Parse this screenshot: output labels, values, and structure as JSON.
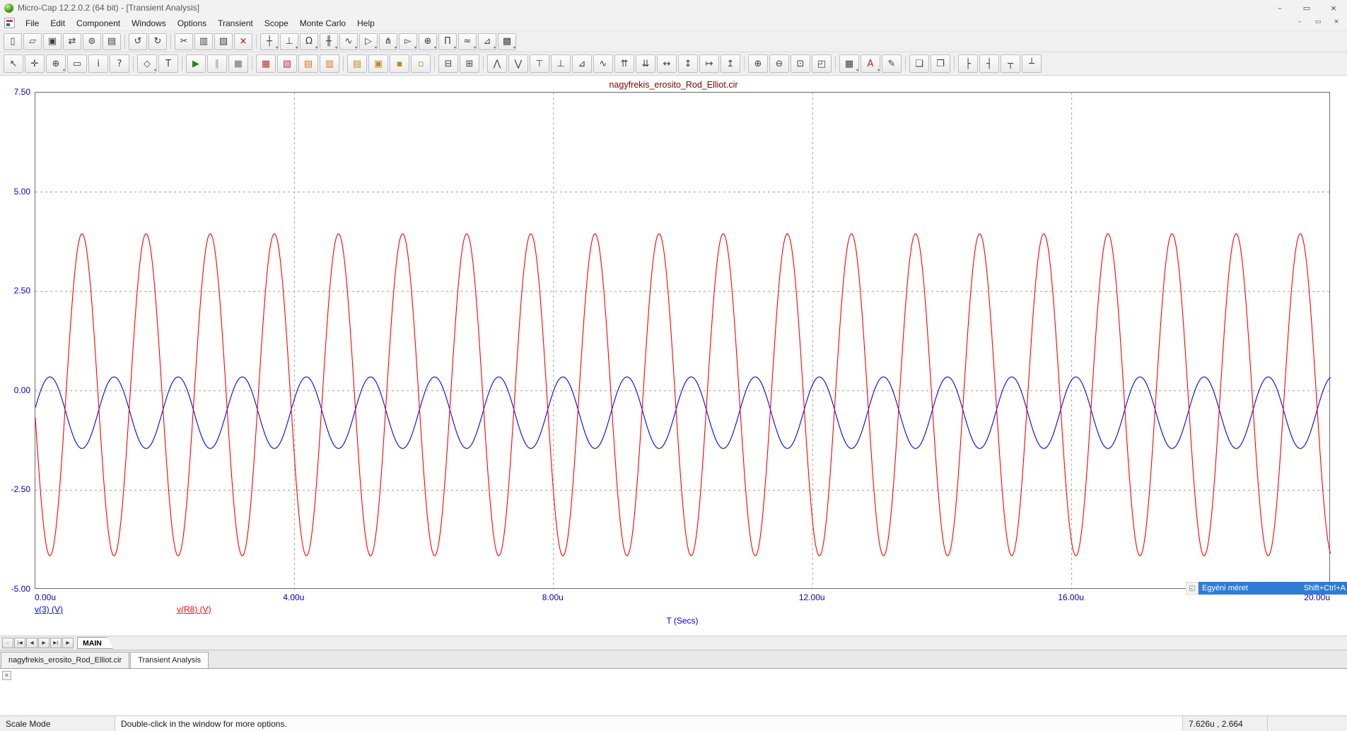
{
  "window": {
    "title": "Micro-Cap 12.2.0.2 (64 bit) - [Transient Analysis]",
    "controls": [
      {
        "name": "minimize",
        "glyph": "–"
      },
      {
        "name": "restore",
        "glyph": "▭"
      },
      {
        "name": "close",
        "glyph": "×"
      }
    ],
    "child_controls": [
      {
        "name": "child-minimize",
        "glyph": "–"
      },
      {
        "name": "child-restore",
        "glyph": "▭"
      },
      {
        "name": "child-close",
        "glyph": "×"
      }
    ]
  },
  "menu": {
    "items": [
      "File",
      "Edit",
      "Component",
      "Windows",
      "Options",
      "Transient",
      "Scope",
      "Monte Carlo",
      "Help"
    ]
  },
  "toolbar_file": {
    "items": [
      {
        "name": "new-file",
        "glyph": "▯"
      },
      {
        "name": "open-file",
        "glyph": "▱"
      },
      {
        "name": "save-file",
        "glyph": "▣"
      },
      {
        "name": "translate",
        "glyph": "⇄"
      },
      {
        "name": "session",
        "glyph": "⊚"
      },
      {
        "name": "print",
        "glyph": "▤"
      },
      {
        "type": "sep"
      },
      {
        "name": "undo",
        "glyph": "↺"
      },
      {
        "name": "redo",
        "glyph": "↻"
      },
      {
        "type": "sep"
      },
      {
        "name": "cut",
        "glyph": "✂"
      },
      {
        "name": "copy",
        "glyph": "▥"
      },
      {
        "name": "paste",
        "glyph": "▧"
      },
      {
        "name": "delete",
        "glyph": "×",
        "color": "#b00000"
      },
      {
        "type": "sep"
      },
      {
        "name": "wire-mode",
        "glyph": "┼",
        "dropdown": true
      },
      {
        "name": "ground-component",
        "glyph": "⊥",
        "dropdown": true
      },
      {
        "name": "resistor-component",
        "glyph": "Ω",
        "dropdown": true
      },
      {
        "name": "capacitor-component",
        "glyph": "╫",
        "dropdown": true
      },
      {
        "name": "inductor-component",
        "glyph": "∿",
        "dropdown": true
      },
      {
        "name": "diode-component",
        "glyph": "▷",
        "dropdown": true
      },
      {
        "name": "bjt-component",
        "glyph": "⋔",
        "dropdown": true
      },
      {
        "name": "opamp-component",
        "glyph": "▻",
        "dropdown": true
      },
      {
        "name": "source-component",
        "glyph": "⊕",
        "dropdown": true
      },
      {
        "name": "pulse-source-component",
        "glyph": "Π",
        "dropdown": true
      },
      {
        "name": "sine-source-component",
        "glyph": "≈",
        "dropdown": true
      },
      {
        "name": "switch-component",
        "glyph": "⊿",
        "dropdown": true
      },
      {
        "name": "macro-component",
        "glyph": "▩",
        "dropdown": true
      }
    ]
  },
  "toolbar_analysis": {
    "items": [
      {
        "name": "select-mode",
        "glyph": "↖"
      },
      {
        "name": "pan-mode",
        "glyph": "✛"
      },
      {
        "name": "zoom-mode",
        "glyph": "⊕",
        "dropdown": true
      },
      {
        "name": "select-region-mode",
        "glyph": "▭"
      },
      {
        "name": "info-mode",
        "glyph": "i"
      },
      {
        "name": "help-mode",
        "glyph": "?"
      },
      {
        "type": "sep"
      },
      {
        "name": "graphics-mode",
        "glyph": "◇",
        "dropdown": true
      },
      {
        "name": "text-mode",
        "glyph": "T"
      },
      {
        "type": "sep"
      },
      {
        "name": "run-analysis",
        "glyph": "▶",
        "color": "#1d8a1d"
      },
      {
        "name": "pause-analysis",
        "glyph": "∥",
        "color": "#9a9a9a"
      },
      {
        "name": "stop-analysis",
        "glyph": "■",
        "color": "#9a9a9a"
      },
      {
        "type": "sep"
      },
      {
        "name": "analysis-limits",
        "glyph": "▦",
        "color": "#c03030"
      },
      {
        "name": "stepping",
        "glyph": "▧",
        "color": "#c03030"
      },
      {
        "name": "optimize",
        "glyph": "▤",
        "color": "#d07a20"
      },
      {
        "name": "state-variables",
        "glyph": "▥",
        "color": "#d07a20"
      },
      {
        "type": "sep"
      },
      {
        "name": "numeric-output",
        "glyph": "▤",
        "color": "#c08820"
      },
      {
        "name": "watch",
        "glyph": "▣",
        "color": "#c08820"
      },
      {
        "name": "breakpoints",
        "glyph": "▪",
        "color": "#c08820"
      },
      {
        "name": "animate",
        "glyph": "▫",
        "color": "#c08820"
      },
      {
        "type": "sep"
      },
      {
        "name": "split-horizontal",
        "glyph": "⊟"
      },
      {
        "name": "split-vertical",
        "glyph": "⊞"
      },
      {
        "type": "sep"
      },
      {
        "name": "peak-tag",
        "glyph": "⋀"
      },
      {
        "name": "valley-tag",
        "glyph": "⋁"
      },
      {
        "name": "high-tag",
        "glyph": "⊤"
      },
      {
        "name": "low-tag",
        "glyph": "⊥"
      },
      {
        "name": "slope-tag",
        "glyph": "⊿"
      },
      {
        "name": "inflection-tag",
        "glyph": "∿"
      },
      {
        "name": "global-high",
        "glyph": "⇈"
      },
      {
        "name": "global-low",
        "glyph": "⇊"
      },
      {
        "name": "horizontal-tag",
        "glyph": "↔"
      },
      {
        "name": "vertical-tag",
        "glyph": "↕"
      },
      {
        "name": "go-to-x",
        "glyph": "↦"
      },
      {
        "name": "go-to-y",
        "glyph": "↥"
      },
      {
        "type": "sep"
      },
      {
        "name": "zoom-in",
        "glyph": "⊕"
      },
      {
        "name": "zoom-out",
        "glyph": "⊖"
      },
      {
        "name": "auto-scale",
        "glyph": "⊡"
      },
      {
        "name": "restore-scale",
        "glyph": "◰"
      },
      {
        "type": "sep"
      },
      {
        "name": "properties-grid",
        "glyph": "▦",
        "dropdown": true
      },
      {
        "name": "font-color",
        "glyph": "A",
        "color": "#c02020",
        "dropdown": true
      },
      {
        "name": "edit-annotation",
        "glyph": "✎"
      },
      {
        "type": "sep"
      },
      {
        "name": "copy-page",
        "glyph": "❏"
      },
      {
        "name": "duplicate-page",
        "glyph": "❐"
      },
      {
        "type": "sep"
      },
      {
        "name": "align-left",
        "glyph": "├"
      },
      {
        "name": "align-right",
        "glyph": "┤"
      },
      {
        "name": "align-top",
        "glyph": "┬"
      },
      {
        "name": "align-bottom",
        "glyph": "┴"
      }
    ]
  },
  "chart_data": {
    "type": "line",
    "title": "nagyfrekis_erosito_Rod_Elliot.cir",
    "title_color": "#800000",
    "xlabel": "T (Secs)",
    "axis_label_color": "#0000cc",
    "grid_color": "#a0a0a0",
    "grid": true,
    "xlim": [
      0,
      20
    ],
    "ylim": [
      -5.0,
      7.5
    ],
    "x_ticks": [
      {
        "value": 0,
        "label": "0.00u"
      },
      {
        "value": 4,
        "label": "4.00u"
      },
      {
        "value": 8,
        "label": "8.00u"
      },
      {
        "value": 12,
        "label": "12.00u"
      },
      {
        "value": 16,
        "label": "16.00u"
      },
      {
        "value": 20,
        "label": "20.00u"
      }
    ],
    "y_ticks": [
      {
        "value": 7.5,
        "label": "7.50"
      },
      {
        "value": 5.0,
        "label": "5.00"
      },
      {
        "value": 2.5,
        "label": "2.50"
      },
      {
        "value": 0.0,
        "label": "0.00"
      },
      {
        "value": -2.5,
        "label": "-2.50"
      },
      {
        "value": -5.0,
        "label": "-5.00"
      }
    ],
    "grid_x": [
      4,
      8,
      12,
      16
    ],
    "grid_y": [
      5.0,
      2.5,
      0.0,
      -2.5
    ],
    "series": [
      {
        "name": "v(3) (V)",
        "color": "#0000ff",
        "waveform": "sine",
        "amplitude": 0.9,
        "offset": -0.55,
        "period_us": 0.99,
        "peak_at_us": 0.225
      },
      {
        "name": "v(R8) (V)",
        "color": "#ff0000",
        "waveform": "sine",
        "amplitude": 4.05,
        "offset": -0.1,
        "period_us": 0.99,
        "peak_at_us": 0.72
      }
    ],
    "legend_position": "below-left"
  },
  "overlay": {
    "icon_glyph": "◱",
    "label": "Egyéni méret",
    "shortcut": "Shift+Ctrl+A",
    "highlight_color": "#2f7cd6"
  },
  "page_strip": {
    "buttons": [
      {
        "name": "hide-tabs",
        "glyph": "–"
      },
      {
        "name": "first-page",
        "glyph": "|◀"
      },
      {
        "name": "previous-page",
        "glyph": "◀"
      },
      {
        "name": "next-page",
        "glyph": "▶"
      },
      {
        "name": "last-page",
        "glyph": "▶|"
      },
      {
        "name": "scroll-pages",
        "glyph": "▶"
      }
    ],
    "tab_label": "MAIN"
  },
  "doc_tabs": [
    {
      "label": "nagyfrekis_erosito_Rod_Elliot.cir"
    },
    {
      "label": "Transient Analysis",
      "active": true
    }
  ],
  "output_panel": {
    "close_glyph": "×"
  },
  "status_bar": {
    "mode": "Scale Mode",
    "hint": "Double-click in the window for more options.",
    "cursor_position": "7.626u , 2.664"
  }
}
